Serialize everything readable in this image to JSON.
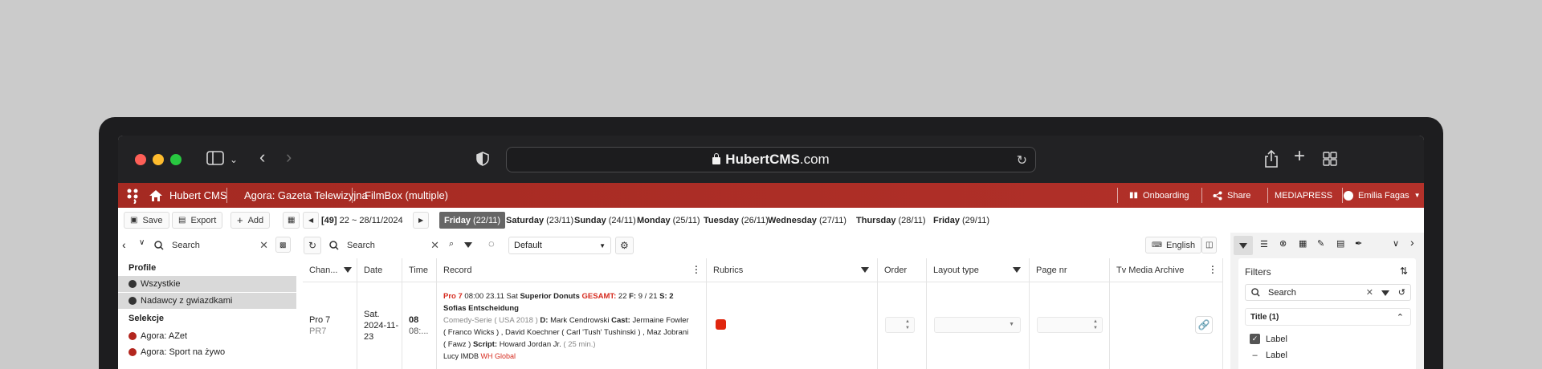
{
  "browser": {
    "url_host": "HubertCMS",
    "url_tld": ".com"
  },
  "topbar": {
    "app_name": "Hubert CMS",
    "breadcrumb_1": "Agora: Gazeta Telewizyjna",
    "breadcrumb_2": "FilmBox (multiple)",
    "onboarding": "Onboarding",
    "share": "Share",
    "mediapress": "MEDIAPRESS",
    "user": "Emilia Fagas"
  },
  "toolbar": {
    "save": "Save",
    "export": "Export",
    "add": "Add",
    "week_number": "[49]",
    "week_range": "22 ~ 28/11/2024",
    "days": [
      {
        "name": "Friday",
        "date": "(22/11)",
        "active": true
      },
      {
        "name": "Saturday",
        "date": "(23/11)"
      },
      {
        "name": "Sunday",
        "date": "(24/11)"
      },
      {
        "name": "Monday",
        "date": "(25/11)"
      },
      {
        "name": "Tuesday",
        "date": "(26/11)"
      },
      {
        "name": "Wednesday",
        "date": "(27/11)"
      },
      {
        "name": "Thursday",
        "date": "(28/11)"
      },
      {
        "name": "Friday",
        "date": "(29/11)"
      }
    ]
  },
  "toolbar2": {
    "left_search_placeholder": "Search",
    "search_placeholder": "Search",
    "view_select": "Default",
    "language": "English"
  },
  "left_panel": {
    "profile_heading": "Profile",
    "profile_items": [
      "Wszystkie",
      "Nadawcy z gwiazdkami"
    ],
    "selections_heading": "Selekcje",
    "selection_items": [
      "Agora: AZet",
      "Agora: Sport na żywo"
    ]
  },
  "grid": {
    "columns": [
      "Chan...",
      "Date",
      "Time",
      "Record",
      "Rubrics",
      "Order",
      "Layout type",
      "Page nr",
      "Tv Media Archive"
    ],
    "row": {
      "channel": "Pro 7",
      "channel_code": "PR7",
      "date_line1": "Sat.",
      "date_line2": "2024-11-",
      "date_line3": "23",
      "time_bold": "08",
      "time_sub": "08:...",
      "rec_channel": "Pro 7",
      "rec_time": "08:00",
      "rec_end": "23.11",
      "rec_day": "Sat",
      "rec_title": "Superior Donuts",
      "rec_gesamt": "GESAMT:",
      "rec_nums": "22",
      "rec_f_label": "F:",
      "rec_f": "9 / 21",
      "rec_s_label": "S:",
      "rec_s": "2",
      "rec_subtitle": "Sofias Entscheidung",
      "rec_genre": "Comedy-Serie ( USA 2018 )",
      "rec_d_label": "D:",
      "rec_director": "Mark Cendrowski",
      "rec_cast_label": "Cast:",
      "rec_cast_1": "Jermaine Fowler",
      "rec_cast_2": "( Franco Wicks ) , David Koechner ( Carl 'Tush' Tushinski ) , Maz Jobrani",
      "rec_cast_3": "( Fawz )",
      "rec_script_label": "Script:",
      "rec_script": "Howard Jordan Jr.",
      "rec_duration": "( 25 min.)",
      "rec_tag1": "Lucy",
      "rec_tag2": "IMDB",
      "rec_tag3": "WH Global"
    }
  },
  "right_panel": {
    "filters_title": "Filters",
    "search_placeholder": "Search",
    "title_group": "Title (1)",
    "label_checked": "Label",
    "label_minus": "Label"
  },
  "colors": {
    "brand": "#a52a22",
    "rubric": "#e0260e",
    "accent_red": "#d62b1f"
  }
}
